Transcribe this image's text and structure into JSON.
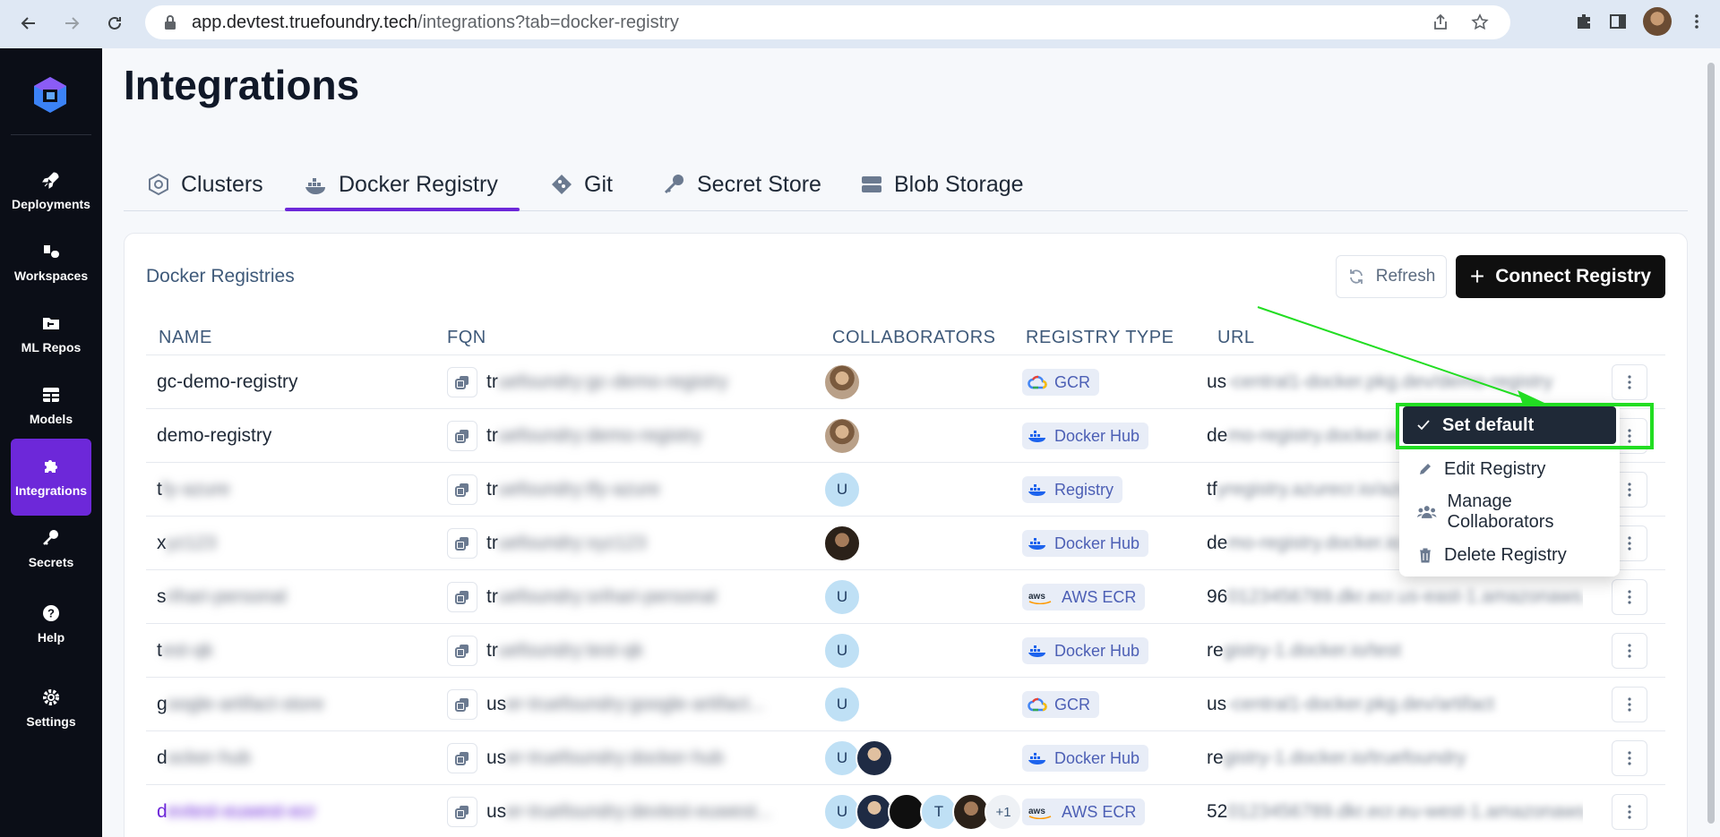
{
  "browser": {
    "url_host": "app.devtest.truefoundry.tech",
    "url_path": "/integrations?tab=docker-registry"
  },
  "sidebar": {
    "items": [
      {
        "label": "Deployments",
        "icon": "rocket-icon"
      },
      {
        "label": "Workspaces",
        "icon": "workspace-icon"
      },
      {
        "label": "ML Repos",
        "icon": "ml-repo-icon"
      },
      {
        "label": "Models",
        "icon": "models-icon"
      },
      {
        "label": "Integrations",
        "icon": "puzzle-icon",
        "active": true
      },
      {
        "label": "Secrets",
        "icon": "key-icon"
      },
      {
        "label": "Help",
        "icon": "help-icon"
      },
      {
        "label": "Settings",
        "icon": "gear-icon"
      }
    ]
  },
  "page": {
    "title": "Integrations"
  },
  "tabs": [
    {
      "label": "Clusters",
      "icon": "cluster-icon"
    },
    {
      "label": "Docker Registry",
      "icon": "docker-icon",
      "active": true
    },
    {
      "label": "Git",
      "icon": "git-icon"
    },
    {
      "label": "Secret Store",
      "icon": "key-icon"
    },
    {
      "label": "Blob Storage",
      "icon": "storage-icon"
    }
  ],
  "card": {
    "title": "Docker Registries",
    "refresh_label": "Refresh",
    "connect_label": "Connect Registry"
  },
  "table": {
    "columns": [
      "NAME",
      "FQN",
      "COLLABORATORS",
      "REGISTRY TYPE",
      "URL"
    ],
    "rows": [
      {
        "name": "gc-demo-registry",
        "fqn_prefix": "tr",
        "fqn_hidden": "uefoundry:gc-demo-registry",
        "type": "GCR",
        "url_prefix": "us",
        "url_hidden": "-central1-docker.pkg.dev/demo-registry"
      },
      {
        "name": "demo-registry",
        "fqn_prefix": "tr",
        "fqn_hidden": "uefoundry:demo-registry",
        "type": "Docker Hub",
        "url_prefix": "de",
        "url_hidden": "mo-registry.docker.io"
      },
      {
        "name_prefix": "t",
        "name_hidden": "fy-azure",
        "fqn_prefix": "tr",
        "fqn_hidden": "uefoundry:tfy-azure",
        "type": "Registry",
        "url_prefix": "tf",
        "url_hidden": "yregistry.azurecr.io/azure"
      },
      {
        "name_prefix": "x",
        "name_hidden": "yz123",
        "fqn_prefix": "tr",
        "fqn_hidden": "uefoundry:xyz123",
        "type": "Docker Hub",
        "url_prefix": "de",
        "url_hidden": "mo-registry.docker.io"
      },
      {
        "name_prefix": "s",
        "name_hidden": "rihari-personal",
        "fqn_prefix": "tr",
        "fqn_hidden": "uefoundry:srihari-personal",
        "type": "AWS ECR",
        "url_prefix": "96",
        "url_hidden": "0123456789.dkr.ecr.us-east-1.amazonaws.com"
      },
      {
        "name_prefix": "t",
        "name_hidden": "est-qk",
        "fqn_prefix": "tr",
        "fqn_hidden": "uefoundry:test-qk",
        "type": "Docker Hub",
        "url_prefix": "re",
        "url_hidden": "gistry-1.docker.io/test"
      },
      {
        "name_prefix": "g",
        "name_hidden": "oogle-artifact-store",
        "fqn_prefix": "us",
        "fqn_hidden": "er-truefoundry:google-artifact...",
        "type": "GCR",
        "url_prefix": "us",
        "url_hidden": "-central1-docker.pkg.dev/artifact"
      },
      {
        "name_prefix": "d",
        "name_hidden": "ocker-hub",
        "fqn_prefix": "us",
        "fqn_hidden": "er-truefoundry:docker-hub",
        "type": "Docker Hub",
        "url_prefix": "re",
        "url_hidden": "gistry-1.docker.io/truefoundry"
      },
      {
        "name_prefix": "d",
        "name_hidden": "evtest-euwest-ecr",
        "fqn_prefix": "us",
        "fqn_hidden": "er-truefoundry:devtest-euwest...",
        "type": "AWS ECR",
        "url_prefix": "52",
        "url_hidden": "0123456789.dkr.ecr.eu-west-1.amazonaws.com"
      }
    ],
    "collaborators": [
      [
        "photo"
      ],
      [
        "photo"
      ],
      [
        "U"
      ],
      [
        "photo-dark"
      ],
      [
        "U"
      ],
      [
        "U"
      ],
      [
        "U"
      ],
      [
        "U",
        "photo"
      ],
      [
        "U",
        "photo",
        "dark",
        "T",
        "photo-dark",
        "+1"
      ]
    ]
  },
  "menu": {
    "items": [
      {
        "label": "Set default",
        "icon": "check-icon"
      },
      {
        "label": "Edit Registry",
        "icon": "pencil-icon"
      },
      {
        "label": "Manage Collaborators",
        "icon": "users-icon"
      },
      {
        "label": "Delete Registry",
        "icon": "trash-icon"
      }
    ]
  },
  "colors": {
    "accent": "#6d28d9",
    "sidebar_bg": "#0b0e17",
    "highlight": "#22dd22"
  }
}
